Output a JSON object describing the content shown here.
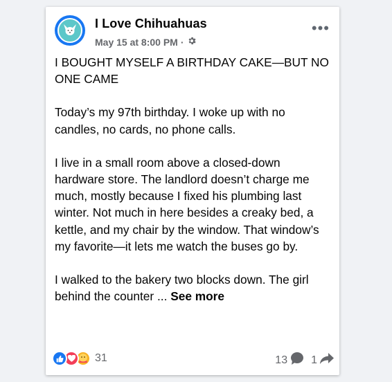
{
  "post": {
    "page_name": "I Love Chihuahuas",
    "date": "May 15 at 8:00 PM",
    "separator": "·",
    "privacy_icon": "gear-icon",
    "more_icon": "more-options-icon",
    "title": "I BOUGHT MYSELF A BIRTHDAY CAKE—BUT NO ONE CAME",
    "paragraphs": [
      "Today’s my 97th birthday. I woke up with no candles, no cards, no phone calls.",
      "I live in a small room above a closed-down hardware store. The landlord doesn’t charge me much, mostly because I fixed his plumbing last winter. Not much in here besides a creaky bed, a kettle, and my chair by the window. That window’s my favorite—it lets me watch the buses go by."
    ],
    "last_paragraph": "I walked to the bakery two blocks down. The girl behind the counter ...",
    "see_more": "See more"
  },
  "footer": {
    "reaction_icons": [
      "like-icon",
      "love-icon",
      "care-icon"
    ],
    "reaction_count": "31",
    "comment_count": "13",
    "share_count": "1"
  },
  "colors": {
    "background": "#f0f2f5",
    "brand_blue": "#1877f2",
    "avatar_teal": "#5cc7c9",
    "text": "#050505",
    "secondary_text": "#65676b"
  }
}
